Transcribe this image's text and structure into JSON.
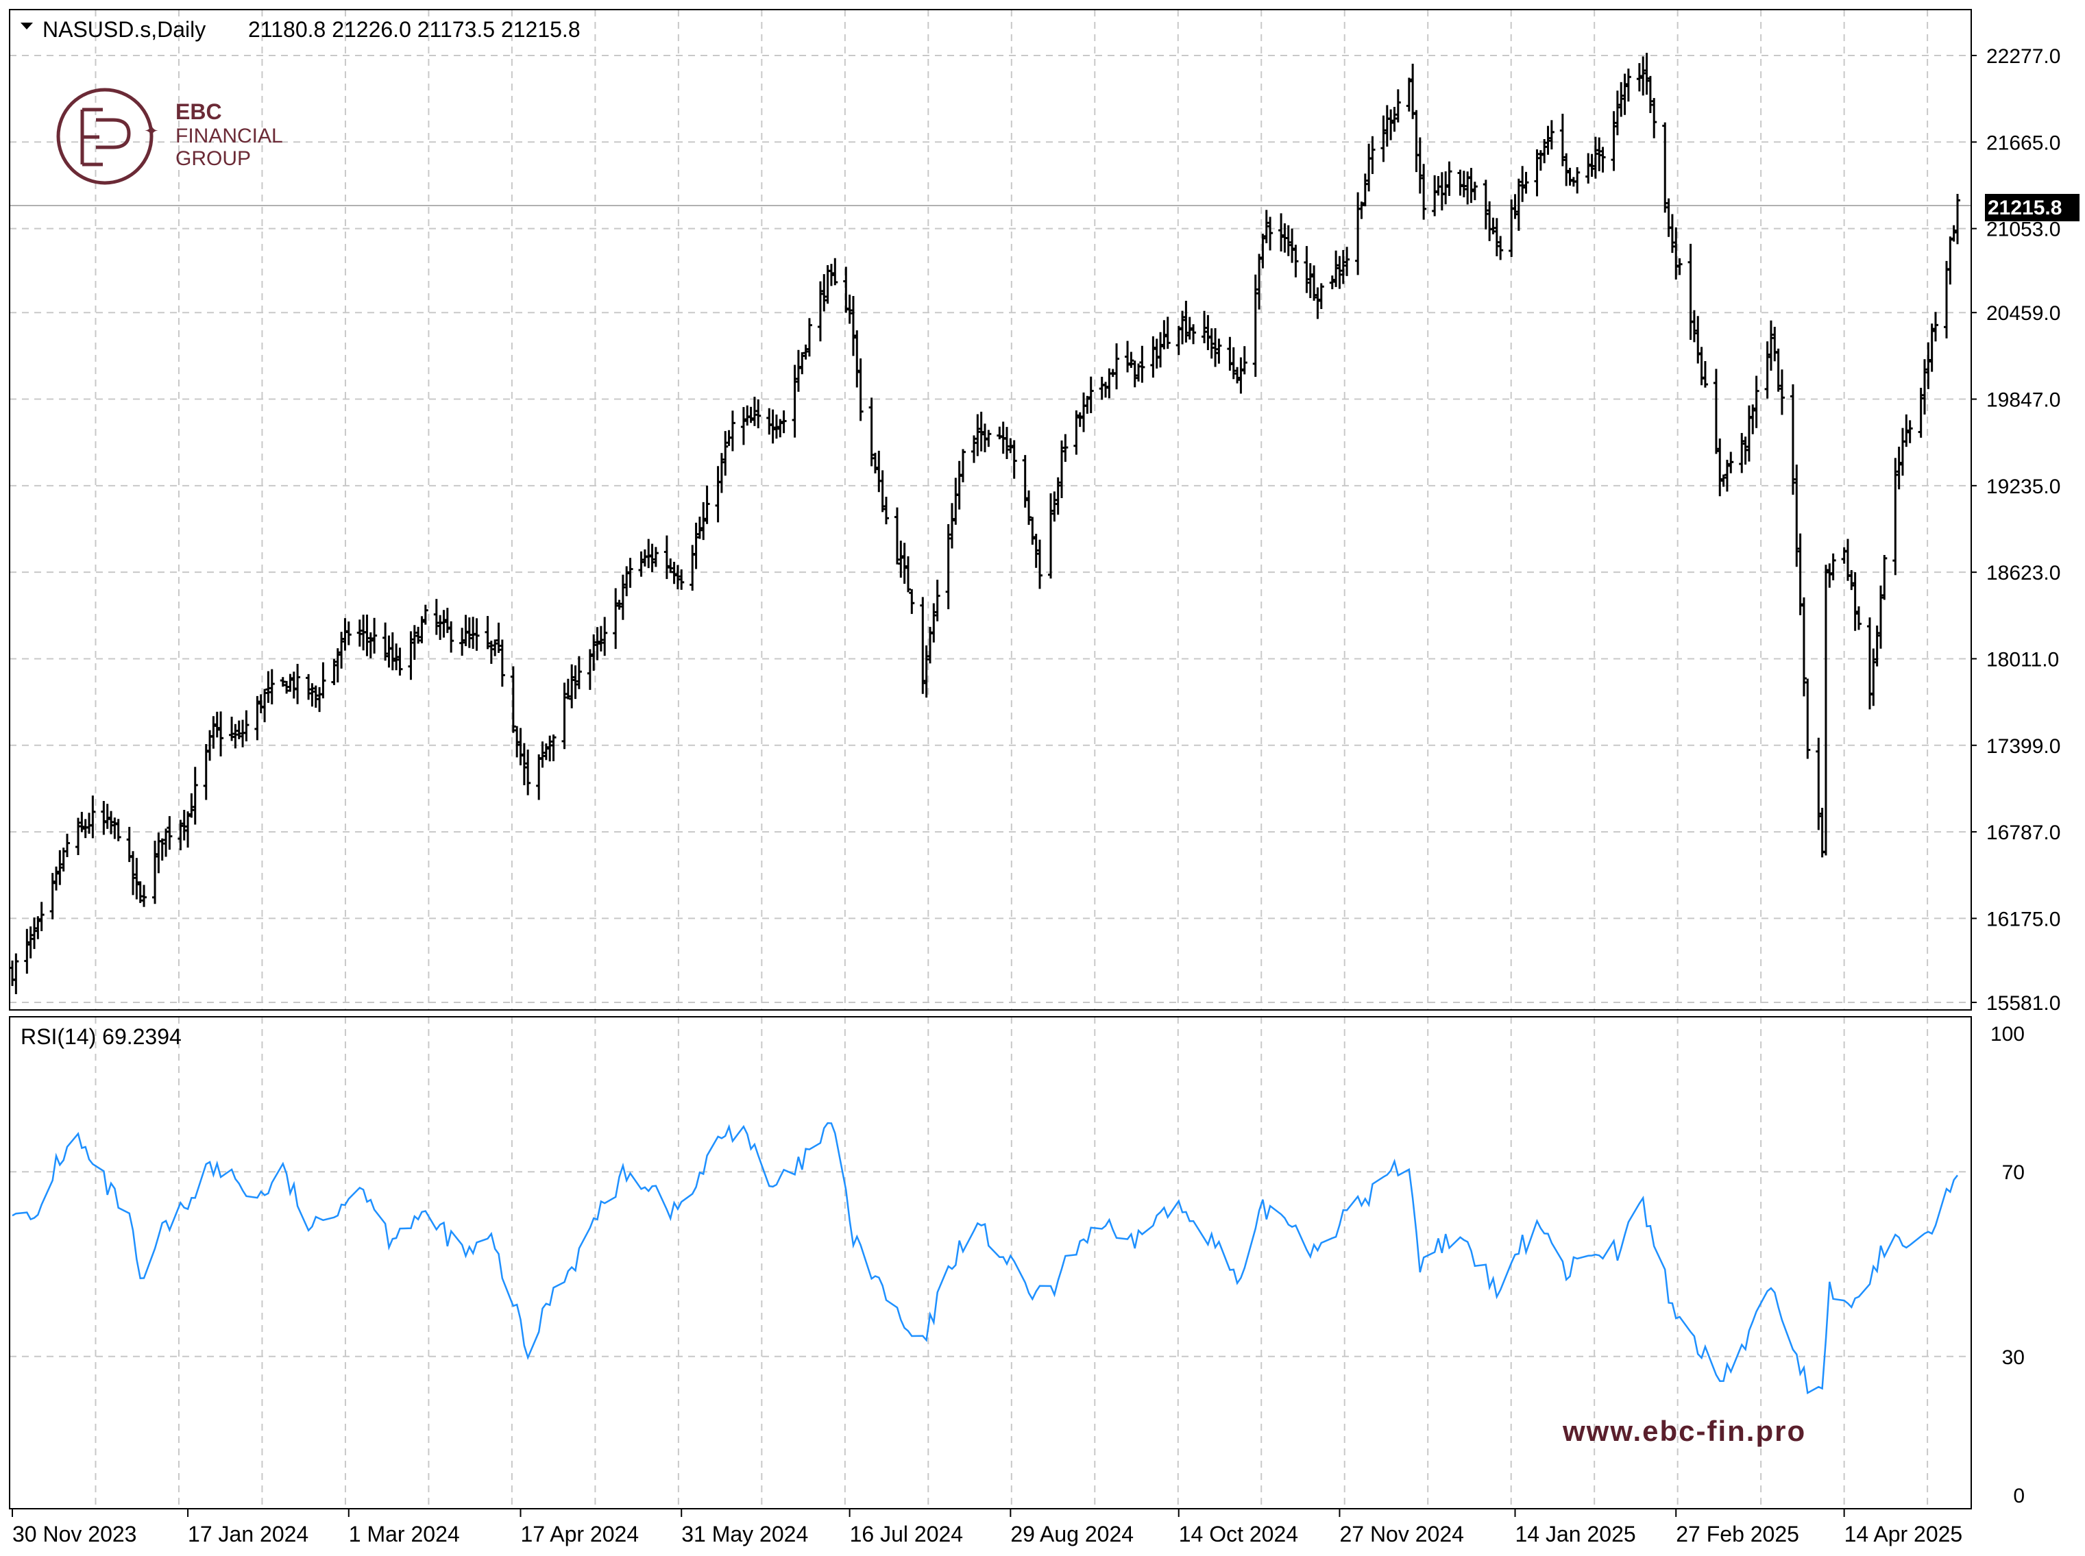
{
  "header": {
    "symbol": "NASUSD.s,Daily",
    "ohlc": "21180.8 21226.0 21173.5 21215.8"
  },
  "logo": {
    "line1": "EBC",
    "line2": "FINANCIAL",
    "line3": "GROUP",
    "color": "#6b2a36"
  },
  "watermark": {
    "text": "www.ebc-fin.pro",
    "color": "#5a1f2c"
  },
  "colors": {
    "bars": "#000000",
    "rsi_line": "#1e90ff",
    "grid": "#c8c8c8",
    "current_price_bg": "#000000",
    "current_price_text": "#ffffff"
  },
  "rsi": {
    "label": "RSI(14) 69.2394",
    "period": 14,
    "value": 69.2394
  },
  "chart_data": [
    {
      "type": "ohlc",
      "title": "NASUSD.s,Daily",
      "timeframe": "Daily",
      "y_ticks": [
        "22277.0",
        "21665.0",
        "21053.0",
        "20459.0",
        "19847.0",
        "19235.0",
        "18623.0",
        "18011.0",
        "17399.0",
        "16787.0",
        "16175.0",
        "15581.0"
      ],
      "ylim": [
        15581,
        22277
      ],
      "current_price": "21215.8",
      "x_ticks": [
        "30 Nov 2023",
        "17 Jan 2024",
        "1 Mar 2024",
        "17 Apr 2024",
        "31 May 2024",
        "16 Jul 2024",
        "29 Aug 2024",
        "14 Oct 2024",
        "27 Nov 2024",
        "14 Jan 2025",
        "27 Feb 2025",
        "14 Apr 2025"
      ],
      "grid": true,
      "approx_close_path": [
        [
          "2023-11-30",
          15800
        ],
        [
          "2023-12-08",
          16150
        ],
        [
          "2023-12-15",
          16700
        ],
        [
          "2023-12-22",
          16880
        ],
        [
          "2023-12-29",
          16800
        ],
        [
          "2024-01-04",
          16300
        ],
        [
          "2024-01-10",
          16750
        ],
        [
          "2024-01-17",
          16900
        ],
        [
          "2024-01-24",
          17500
        ],
        [
          "2024-01-31",
          17450
        ],
        [
          "2024-02-07",
          17750
        ],
        [
          "2024-02-14",
          17850
        ],
        [
          "2024-02-21",
          17750
        ],
        [
          "2024-03-01",
          18200
        ],
        [
          "2024-03-08",
          18150
        ],
        [
          "2024-03-15",
          17950
        ],
        [
          "2024-03-22",
          18300
        ],
        [
          "2024-03-28",
          18200
        ],
        [
          "2024-04-04",
          18150
        ],
        [
          "2024-04-11",
          18050
        ],
        [
          "2024-04-19",
          17100
        ],
        [
          "2024-04-26",
          17500
        ],
        [
          "2024-05-03",
          17950
        ],
        [
          "2024-05-10",
          18150
        ],
        [
          "2024-05-17",
          18650
        ],
        [
          "2024-05-24",
          18750
        ],
        [
          "2024-05-31",
          18600
        ],
        [
          "2024-06-07",
          19050
        ],
        [
          "2024-06-14",
          19650
        ],
        [
          "2024-06-21",
          19700
        ],
        [
          "2024-06-28",
          19700
        ],
        [
          "2024-07-05",
          20350
        ],
        [
          "2024-07-10",
          20700
        ],
        [
          "2024-07-16",
          20500
        ],
        [
          "2024-07-19",
          19800
        ],
        [
          "2024-07-26",
          19000
        ],
        [
          "2024-08-02",
          18450
        ],
        [
          "2024-08-05",
          17900
        ],
        [
          "2024-08-09",
          18450
        ],
        [
          "2024-08-16",
          19450
        ],
        [
          "2024-08-23",
          19650
        ],
        [
          "2024-08-29",
          19550
        ],
        [
          "2024-09-06",
          18650
        ],
        [
          "2024-09-13",
          19550
        ],
        [
          "2024-09-20",
          19850
        ],
        [
          "2024-09-27",
          20100
        ],
        [
          "2024-10-04",
          20050
        ],
        [
          "2024-10-11",
          20300
        ],
        [
          "2024-10-14",
          20400
        ],
        [
          "2024-10-21",
          20300
        ],
        [
          "2024-10-31",
          20000
        ],
        [
          "2024-11-07",
          21100
        ],
        [
          "2024-11-14",
          20900
        ],
        [
          "2024-11-21",
          20600
        ],
        [
          "2024-11-29",
          20850
        ],
        [
          "2024-12-06",
          21600
        ],
        [
          "2024-12-16",
          22100
        ],
        [
          "2024-12-20",
          21150
        ],
        [
          "2024-12-27",
          21400
        ],
        [
          "2025-01-03",
          21350
        ],
        [
          "2025-01-10",
          20900
        ],
        [
          "2025-01-15",
          21300
        ],
        [
          "2025-01-24",
          21700
        ],
        [
          "2025-01-29",
          21350
        ],
        [
          "2025-02-07",
          21600
        ],
        [
          "2025-02-14",
          22100
        ],
        [
          "2025-02-19",
          22150
        ],
        [
          "2025-02-25",
          21050
        ],
        [
          "2025-03-04",
          20350
        ],
        [
          "2025-03-11",
          19300
        ],
        [
          "2025-03-18",
          19550
        ],
        [
          "2025-03-25",
          20300
        ],
        [
          "2025-03-31",
          19300
        ],
        [
          "2025-04-04",
          17400
        ],
        [
          "2025-04-08",
          16700
        ],
        [
          "2025-04-09",
          18600
        ],
        [
          "2025-04-14",
          18800
        ],
        [
          "2025-04-21",
          17800
        ],
        [
          "2025-04-28",
          19350
        ],
        [
          "2025-05-05",
          19900
        ],
        [
          "2025-05-12",
          20800
        ],
        [
          "2025-05-15",
          21215.8
        ]
      ]
    },
    {
      "type": "line",
      "title": "RSI(14) 69.2394",
      "series_name": "RSI(14)",
      "y_ticks": [
        "100",
        "70",
        "30",
        "0"
      ],
      "ylim": [
        0,
        100
      ],
      "grid": true,
      "last_value": 69.2394,
      "approx_series": [
        [
          "2023-11-30",
          63
        ],
        [
          "2023-12-06",
          58
        ],
        [
          "2023-12-12",
          72
        ],
        [
          "2023-12-18",
          77
        ],
        [
          "2023-12-22",
          71
        ],
        [
          "2024-01-01",
          60
        ],
        [
          "2024-01-04",
          45
        ],
        [
          "2024-01-10",
          57
        ],
        [
          "2024-01-16",
          62
        ],
        [
          "2024-01-22",
          71
        ],
        [
          "2024-01-29",
          69
        ],
        [
          "2024-02-05",
          64
        ],
        [
          "2024-02-12",
          70
        ],
        [
          "2024-02-20",
          57
        ],
        [
          "2024-02-27",
          63
        ],
        [
          "2024-03-05",
          67
        ],
        [
          "2024-03-12",
          56
        ],
        [
          "2024-03-19",
          60
        ],
        [
          "2024-03-26",
          58
        ],
        [
          "2024-04-02",
          52
        ],
        [
          "2024-04-09",
          55
        ],
        [
          "2024-04-15",
          42
        ],
        [
          "2024-04-19",
          30
        ],
        [
          "2024-04-25",
          43
        ],
        [
          "2024-05-02",
          51
        ],
        [
          "2024-05-09",
          62
        ],
        [
          "2024-05-16",
          70
        ],
        [
          "2024-05-23",
          67
        ],
        [
          "2024-05-29",
          61
        ],
        [
          "2024-06-04",
          67
        ],
        [
          "2024-06-11",
          78
        ],
        [
          "2024-06-17",
          80
        ],
        [
          "2024-06-24",
          66
        ],
        [
          "2024-07-01",
          70
        ],
        [
          "2024-07-08",
          77
        ],
        [
          "2024-07-12",
          80
        ],
        [
          "2024-07-17",
          55
        ],
        [
          "2024-07-24",
          46
        ],
        [
          "2024-07-31",
          36
        ],
        [
          "2024-08-05",
          32
        ],
        [
          "2024-08-12",
          49
        ],
        [
          "2024-08-19",
          59
        ],
        [
          "2024-08-26",
          53
        ],
        [
          "2024-09-03",
          44
        ],
        [
          "2024-09-09",
          43
        ],
        [
          "2024-09-16",
          54
        ],
        [
          "2024-09-23",
          59
        ],
        [
          "2024-09-30",
          53
        ],
        [
          "2024-10-07",
          60
        ],
        [
          "2024-10-14",
          62
        ],
        [
          "2024-10-21",
          58
        ],
        [
          "2024-10-31",
          45
        ],
        [
          "2024-11-06",
          62
        ],
        [
          "2024-11-13",
          60
        ],
        [
          "2024-11-20",
          53
        ],
        [
          "2024-11-27",
          59
        ],
        [
          "2024-12-04",
          64
        ],
        [
          "2024-12-11",
          70
        ],
        [
          "2024-12-16",
          72
        ],
        [
          "2024-12-19",
          50
        ],
        [
          "2024-12-27",
          56
        ],
        [
          "2025-01-03",
          51
        ],
        [
          "2025-01-10",
          43
        ],
        [
          "2025-01-15",
          53
        ],
        [
          "2025-01-22",
          59
        ],
        [
          "2025-01-28",
          48
        ],
        [
          "2025-02-04",
          54
        ],
        [
          "2025-02-11",
          53
        ],
        [
          "2025-02-18",
          63
        ],
        [
          "2025-02-21",
          54
        ],
        [
          "2025-02-27",
          39
        ],
        [
          "2025-03-06",
          31
        ],
        [
          "2025-03-11",
          25
        ],
        [
          "2025-03-18",
          33
        ],
        [
          "2025-03-25",
          46
        ],
        [
          "2025-03-31",
          32
        ],
        [
          "2025-04-04",
          24
        ],
        [
          "2025-04-08",
          21
        ],
        [
          "2025-04-10",
          44
        ],
        [
          "2025-04-17",
          41
        ],
        [
          "2025-04-24",
          52
        ],
        [
          "2025-05-01",
          56
        ],
        [
          "2025-05-08",
          59
        ],
        [
          "2025-05-15",
          69.2394
        ]
      ]
    }
  ]
}
